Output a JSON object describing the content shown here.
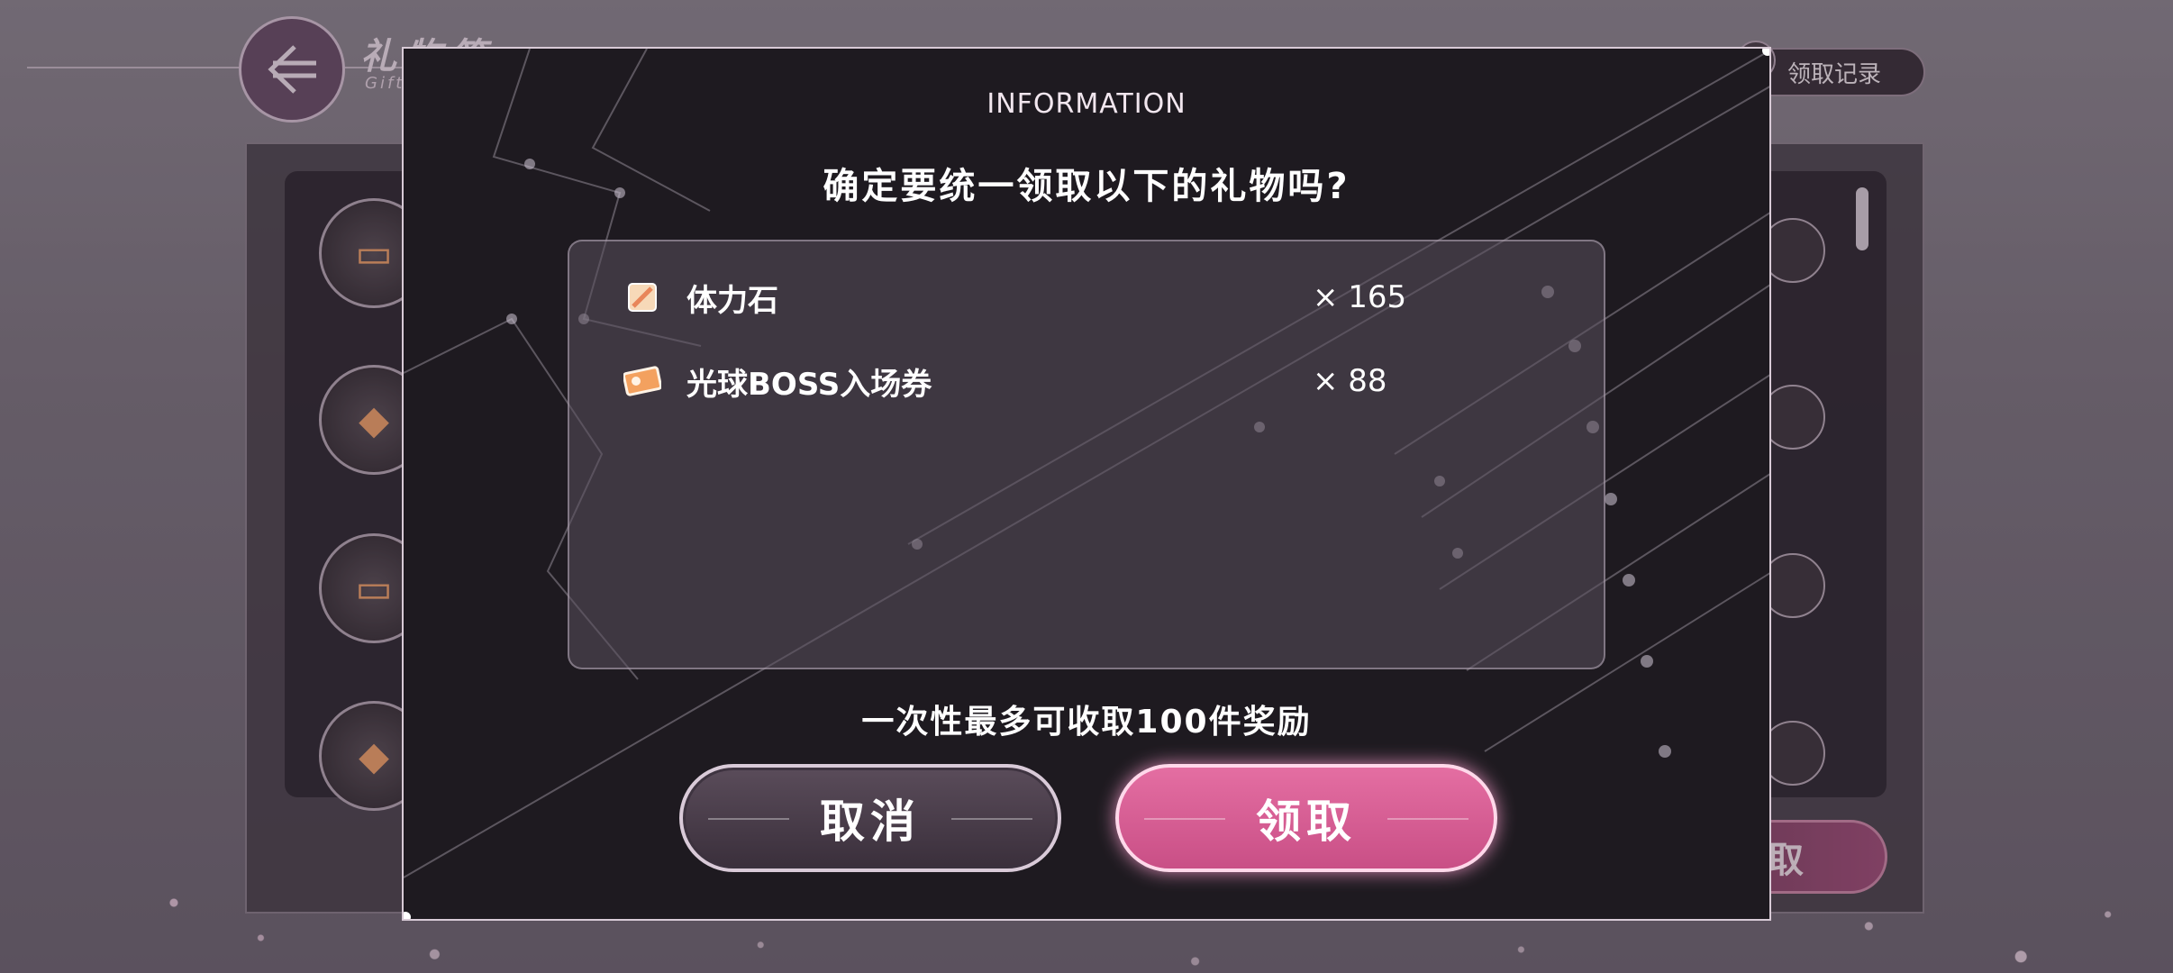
{
  "header": {
    "title": "礼物箱",
    "subtitle": "Gift",
    "history_button": "领取记录"
  },
  "background": {
    "claim_button_tail": "取"
  },
  "dialog": {
    "heading": "INFORMATION",
    "question": "确定要统一领取以下的礼物吗?",
    "items": [
      {
        "name": "体力石",
        "quantity": "× 165",
        "icon": "stamina-stone-icon"
      },
      {
        "name": "光球BOSS入场券",
        "quantity": "× 88",
        "icon": "boss-ticket-icon"
      }
    ],
    "note": "一次性最多可收取100件奖励",
    "cancel_label": "取消",
    "confirm_label": "领取"
  },
  "colors": {
    "accent_pink": "#d85a93",
    "dialog_bg": "#1e1a20",
    "text": "#ffffff"
  }
}
